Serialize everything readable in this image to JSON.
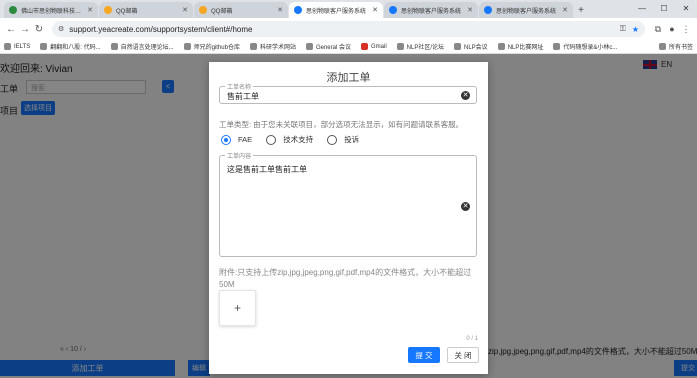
{
  "browser": {
    "tabs": [
      {
        "label": "佛山市思创物联科技有限公司",
        "color": "#2b8a3e",
        "active": false
      },
      {
        "label": "QQ邮箱",
        "color": "#f5a623",
        "active": false
      },
      {
        "label": "QQ邮箱",
        "color": "#f5a623",
        "active": false
      },
      {
        "label": "思创物联客户服务系统",
        "color": "#1677ff",
        "active": true
      },
      {
        "label": "思创物联客户服务系统",
        "color": "#1677ff",
        "active": false
      },
      {
        "label": "思创物联客户服务系统",
        "color": "#1677ff",
        "active": false
      }
    ],
    "new_tab": "+",
    "window_controls": [
      "—",
      "☐",
      "✕"
    ],
    "url": "support.yeacreate.com/supportsystem/client#/home",
    "bookmarks": [
      {
        "label": "IELTS",
        "color": "#888888"
      },
      {
        "label": "翻翻和八股: 代码...",
        "color": "#888888"
      },
      {
        "label": "自然语言处理论坛...",
        "color": "#888888"
      },
      {
        "label": "师兄的github仓库",
        "color": "#888888"
      },
      {
        "label": "科研学术网站",
        "color": "#888888"
      },
      {
        "label": "General 会议",
        "color": "#888888"
      },
      {
        "label": "Gmail",
        "color": "#d93025"
      },
      {
        "label": "NLP社区/论坛",
        "color": "#888888"
      },
      {
        "label": "NLP会议",
        "color": "#888888"
      },
      {
        "label": "NLP比赛网址",
        "color": "#888888"
      },
      {
        "label": "代码随想录&小林c...",
        "color": "#888888"
      }
    ],
    "bookmarks_right": "所有书签"
  },
  "page": {
    "welcome": "欢迎回来: Vivian",
    "language": "EN",
    "ticket_title": "工单",
    "search_placeholder": "搜索",
    "collapse_icon": "<",
    "project_label": "项目",
    "project_button": "选择项目",
    "pager": "«  ‹  10 / ›",
    "add_ticket_button": "添加工单",
    "left_mini_button": "编辑",
    "side_hint": "zip,jpg,jpeg,png,gif,pdf,mp4的文件格式，大小不能超过50M",
    "right_button": "提交"
  },
  "dialog": {
    "title": "添加工单",
    "name_legend": "工单名称",
    "name_value": "售前工单",
    "type_hint": "工单类型: 由于您未关联项目，部分选项无法显示，如有问题请联系客服。",
    "types": [
      {
        "label": "FAE",
        "selected": true
      },
      {
        "label": "技术支持",
        "selected": false
      },
      {
        "label": "投诉",
        "selected": false
      }
    ],
    "content_legend": "工单内容",
    "content_value": "这是售前工单售前工单",
    "attach_hint": "附件:只支持上传zip,jpg,jpeg,png,gif,pdf,mp4的文件格式，大小不能超过50M",
    "upload_icon": "+",
    "counter": "0 / 1",
    "submit_label": "提 交",
    "close_label": "关 闭"
  }
}
